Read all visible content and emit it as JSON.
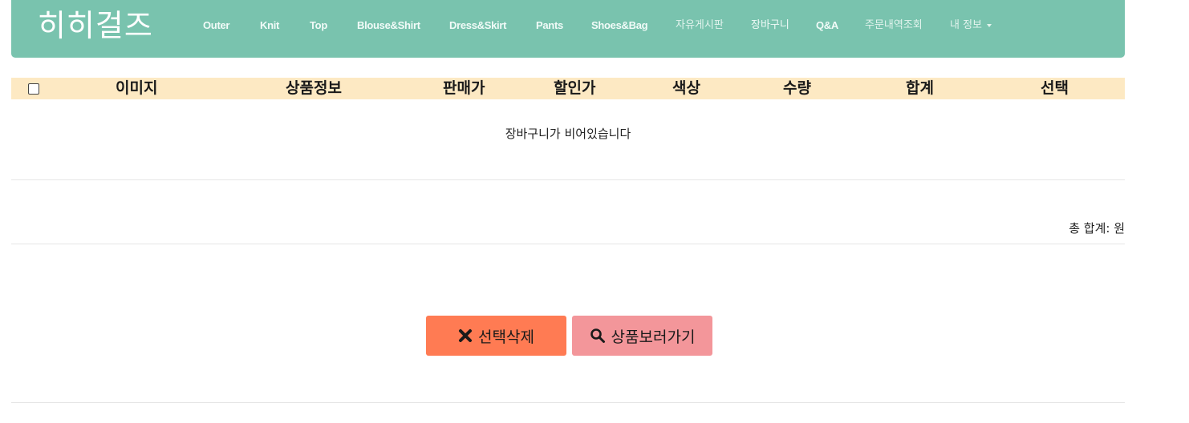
{
  "brand": "히히걸즈",
  "nav": [
    {
      "label": "Outer"
    },
    {
      "label": "Knit"
    },
    {
      "label": "Top"
    },
    {
      "label": "Blouse&Shirt"
    },
    {
      "label": "Dress&Skirt"
    },
    {
      "label": "Pants"
    },
    {
      "label": "Shoes&Bag"
    },
    {
      "label": "자유게시판"
    },
    {
      "label": "장바구니"
    },
    {
      "label": "Q&A"
    },
    {
      "label": "주문내역조회"
    },
    {
      "label": "내 정보"
    }
  ],
  "table": {
    "headers": [
      "이미지",
      "상품정보",
      "판매가",
      "할인가",
      "색상",
      "수량",
      "합계",
      "선택"
    ],
    "empty_message": "장바구니가 비어있습니다"
  },
  "total_label": "총 합계: 원",
  "buttons": {
    "delete": {
      "label": "선택삭제",
      "icon": "close-icon"
    },
    "browse": {
      "label": "상품보러가기",
      "icon": "search-icon"
    }
  },
  "colors": {
    "navbar": "#79c3ae",
    "table_header": "#fde9c3",
    "delete_button": "#ff7b53",
    "browse_button": "#f3969a"
  }
}
